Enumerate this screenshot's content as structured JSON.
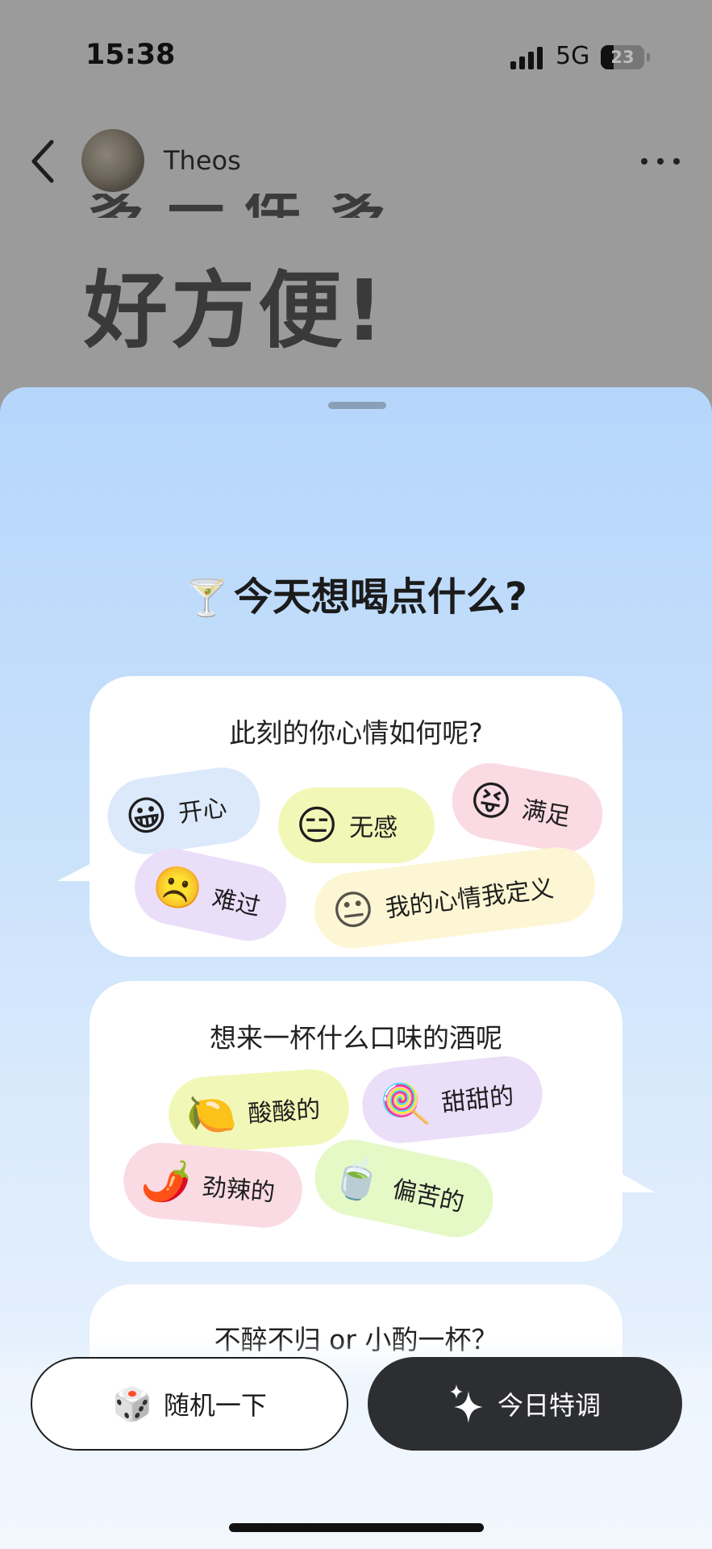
{
  "status_bar": {
    "time": "15:38",
    "network": "5G",
    "battery": "23"
  },
  "header": {
    "username": "Theos"
  },
  "background": {
    "headline": "好方便!",
    "cut_glyphs": [
      "多",
      "一",
      "件",
      "多"
    ]
  },
  "sheet": {
    "title": "今天想喝点什么?",
    "title_emoji": "🍸",
    "mood_card": {
      "question": "此刻的你心情如何呢?",
      "options": [
        {
          "emoji": "😀",
          "label": "开心",
          "color": "#dce9fb"
        },
        {
          "emoji": "😑",
          "label": "无感",
          "color": "#f1f8b7"
        },
        {
          "emoji": "😝",
          "label": "满足",
          "color": "#fadbe3"
        },
        {
          "emoji": "☹️",
          "label": "难过",
          "color": "#ebdef9"
        },
        {
          "emoji": "😐",
          "label": "我的心情我定义",
          "color": "#fdf6d4"
        }
      ]
    },
    "flavor_card": {
      "question": "想来一杯什么口味的酒呢",
      "options": [
        {
          "emoji": "🍋",
          "label": "酸酸的",
          "color": "#f1f8b7"
        },
        {
          "emoji": "🍭",
          "label": "甜甜的",
          "color": "#ebdef9"
        },
        {
          "emoji": "🌶️",
          "label": "劲辣的",
          "color": "#fadbe3"
        },
        {
          "emoji": "🍵",
          "label": "偏苦的",
          "color": "#e5f9c7"
        }
      ]
    },
    "amount_card": {
      "question": "不醉不归 or 小酌一杯？"
    }
  },
  "actions": {
    "random": {
      "emoji": "🎲",
      "label": "随机一下"
    },
    "today": {
      "icon": "sparkle-icon",
      "label": "今日特调"
    }
  },
  "colors": {
    "sheet_top": "#b5d6fb",
    "sheet_bottom": "#ecf4fd",
    "dark_button": "#2d2e31"
  }
}
